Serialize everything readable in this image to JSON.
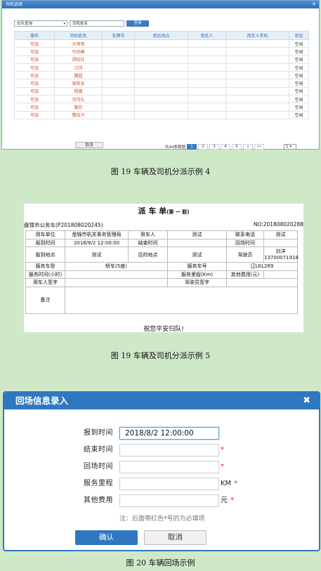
{
  "driver_dialog": {
    "title": "司机选择",
    "close_icon": "✕",
    "filter_select": "车队查询",
    "name_input": "司机姓名",
    "query_button": "查询",
    "columns": [
      "操作",
      "司机姓名",
      "车牌号",
      "到达地点",
      "用车人",
      "用车人手机",
      "状态"
    ],
    "rows": [
      {
        "op": "可选",
        "name": "大帅哥",
        "status": "空闲"
      },
      {
        "op": "可选",
        "name": "马协睡",
        "status": "空闲"
      },
      {
        "op": "可选",
        "name": "郑桂柱",
        "status": "空闲"
      },
      {
        "op": "可选",
        "name": "江伟",
        "status": "空闲"
      },
      {
        "op": "可选",
        "name": "魏超",
        "status": "空闲"
      },
      {
        "op": "可选",
        "name": "谢陈龙",
        "status": "空闲"
      },
      {
        "op": "可选",
        "name": "程璐",
        "status": "空闲"
      },
      {
        "op": "可选",
        "name": "刘伟礼",
        "status": "空闲"
      },
      {
        "op": "可选",
        "name": "冀欣",
        "status": "空闲"
      },
      {
        "op": "可选",
        "name": "曹绍力",
        "status": "空闲"
      }
    ],
    "cancel_button": "取消",
    "total_text": "共44条数据",
    "pages": [
      "1",
      "2",
      "3",
      "4",
      "5",
      "»",
      "»»"
    ],
    "active_page": "1",
    "page_select": "1"
  },
  "caption_1": "图 19   车辆及司机分派示例 4",
  "dispatch_sheet": {
    "title": "派 车 单",
    "title_suffix": "(第 一 联)",
    "left_header": "盘锦市公务车(P201808020245)",
    "right_header": "NO:201808020288",
    "row1": [
      "用车单位",
      "盘锦市机关事务管理局",
      "用车人",
      "测试",
      "联系电话",
      "测试"
    ],
    "row2": [
      "报到时间",
      "2018/8/2 12:00:00",
      "结束时间",
      "",
      "回场时间",
      ""
    ],
    "row3": [
      "报到地点",
      "测试",
      "目的地点",
      "测试",
      "驾驶员",
      "刘洋\n13700071918"
    ],
    "row4": [
      "服务车型",
      "轿车(5座)",
      "服务车号",
      "辽LKL269"
    ],
    "row5": [
      "服务时间(小时)",
      "",
      "服务里程(Km)",
      "",
      "其他费用(元)",
      ""
    ],
    "row6": [
      "用车人签字",
      "",
      "驾驶员签字",
      ""
    ],
    "row7": [
      "备注",
      ""
    ],
    "footer": "祝您平安归队!"
  },
  "caption_2": "图 19   车辆及司机分派示例 5",
  "return_dialog": {
    "title": "回场信息录入",
    "close_icon": "✖",
    "fields": [
      {
        "label": "报到时间",
        "value": "2018/8/2 12:00:00",
        "suffix": "",
        "required": ""
      },
      {
        "label": "结束时间",
        "value": "",
        "suffix": "",
        "required": "*"
      },
      {
        "label": "回场时间",
        "value": "",
        "suffix": "",
        "required": "*"
      },
      {
        "label": "服务里程",
        "value": "",
        "suffix": "KM",
        "required": "*"
      },
      {
        "label": "其他费用",
        "value": "",
        "suffix": "元",
        "required": "*"
      }
    ],
    "note_prefix": "注：后面带红色",
    "note_star": "*",
    "note_suffix": "号的为必填项",
    "ok_button": "确认",
    "cancel_button": "取消"
  },
  "caption_3": "图 20   车辆回场示例"
}
